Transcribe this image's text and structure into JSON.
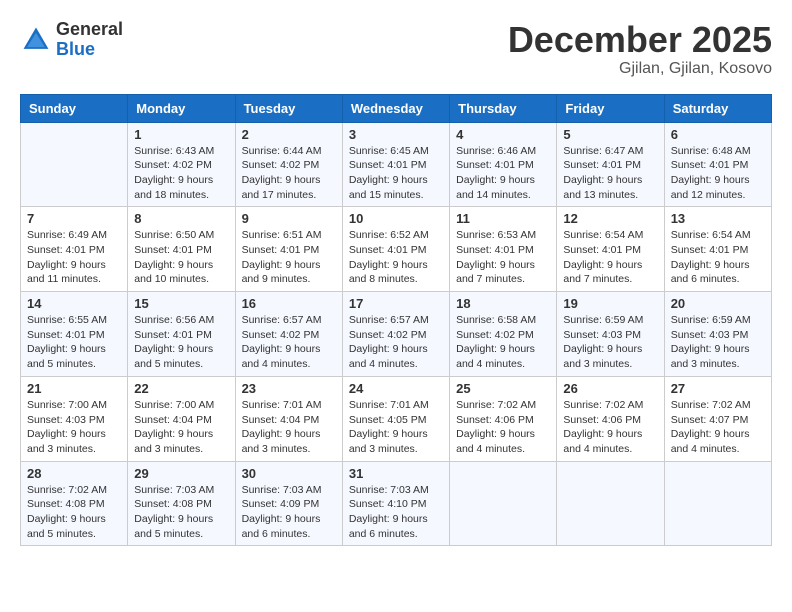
{
  "logo": {
    "general": "General",
    "blue": "Blue"
  },
  "header": {
    "month": "December 2025",
    "location": "Gjilan, Gjilan, Kosovo"
  },
  "days_of_week": [
    "Sunday",
    "Monday",
    "Tuesday",
    "Wednesday",
    "Thursday",
    "Friday",
    "Saturday"
  ],
  "weeks": [
    [
      {
        "day": "",
        "sunrise": "",
        "sunset": "",
        "daylight": ""
      },
      {
        "day": "1",
        "sunrise": "Sunrise: 6:43 AM",
        "sunset": "Sunset: 4:02 PM",
        "daylight": "Daylight: 9 hours and 18 minutes."
      },
      {
        "day": "2",
        "sunrise": "Sunrise: 6:44 AM",
        "sunset": "Sunset: 4:02 PM",
        "daylight": "Daylight: 9 hours and 17 minutes."
      },
      {
        "day": "3",
        "sunrise": "Sunrise: 6:45 AM",
        "sunset": "Sunset: 4:01 PM",
        "daylight": "Daylight: 9 hours and 15 minutes."
      },
      {
        "day": "4",
        "sunrise": "Sunrise: 6:46 AM",
        "sunset": "Sunset: 4:01 PM",
        "daylight": "Daylight: 9 hours and 14 minutes."
      },
      {
        "day": "5",
        "sunrise": "Sunrise: 6:47 AM",
        "sunset": "Sunset: 4:01 PM",
        "daylight": "Daylight: 9 hours and 13 minutes."
      },
      {
        "day": "6",
        "sunrise": "Sunrise: 6:48 AM",
        "sunset": "Sunset: 4:01 PM",
        "daylight": "Daylight: 9 hours and 12 minutes."
      }
    ],
    [
      {
        "day": "7",
        "sunrise": "Sunrise: 6:49 AM",
        "sunset": "Sunset: 4:01 PM",
        "daylight": "Daylight: 9 hours and 11 minutes."
      },
      {
        "day": "8",
        "sunrise": "Sunrise: 6:50 AM",
        "sunset": "Sunset: 4:01 PM",
        "daylight": "Daylight: 9 hours and 10 minutes."
      },
      {
        "day": "9",
        "sunrise": "Sunrise: 6:51 AM",
        "sunset": "Sunset: 4:01 PM",
        "daylight": "Daylight: 9 hours and 9 minutes."
      },
      {
        "day": "10",
        "sunrise": "Sunrise: 6:52 AM",
        "sunset": "Sunset: 4:01 PM",
        "daylight": "Daylight: 9 hours and 8 minutes."
      },
      {
        "day": "11",
        "sunrise": "Sunrise: 6:53 AM",
        "sunset": "Sunset: 4:01 PM",
        "daylight": "Daylight: 9 hours and 7 minutes."
      },
      {
        "day": "12",
        "sunrise": "Sunrise: 6:54 AM",
        "sunset": "Sunset: 4:01 PM",
        "daylight": "Daylight: 9 hours and 7 minutes."
      },
      {
        "day": "13",
        "sunrise": "Sunrise: 6:54 AM",
        "sunset": "Sunset: 4:01 PM",
        "daylight": "Daylight: 9 hours and 6 minutes."
      }
    ],
    [
      {
        "day": "14",
        "sunrise": "Sunrise: 6:55 AM",
        "sunset": "Sunset: 4:01 PM",
        "daylight": "Daylight: 9 hours and 5 minutes."
      },
      {
        "day": "15",
        "sunrise": "Sunrise: 6:56 AM",
        "sunset": "Sunset: 4:01 PM",
        "daylight": "Daylight: 9 hours and 5 minutes."
      },
      {
        "day": "16",
        "sunrise": "Sunrise: 6:57 AM",
        "sunset": "Sunset: 4:02 PM",
        "daylight": "Daylight: 9 hours and 4 minutes."
      },
      {
        "day": "17",
        "sunrise": "Sunrise: 6:57 AM",
        "sunset": "Sunset: 4:02 PM",
        "daylight": "Daylight: 9 hours and 4 minutes."
      },
      {
        "day": "18",
        "sunrise": "Sunrise: 6:58 AM",
        "sunset": "Sunset: 4:02 PM",
        "daylight": "Daylight: 9 hours and 4 minutes."
      },
      {
        "day": "19",
        "sunrise": "Sunrise: 6:59 AM",
        "sunset": "Sunset: 4:03 PM",
        "daylight": "Daylight: 9 hours and 3 minutes."
      },
      {
        "day": "20",
        "sunrise": "Sunrise: 6:59 AM",
        "sunset": "Sunset: 4:03 PM",
        "daylight": "Daylight: 9 hours and 3 minutes."
      }
    ],
    [
      {
        "day": "21",
        "sunrise": "Sunrise: 7:00 AM",
        "sunset": "Sunset: 4:03 PM",
        "daylight": "Daylight: 9 hours and 3 minutes."
      },
      {
        "day": "22",
        "sunrise": "Sunrise: 7:00 AM",
        "sunset": "Sunset: 4:04 PM",
        "daylight": "Daylight: 9 hours and 3 minutes."
      },
      {
        "day": "23",
        "sunrise": "Sunrise: 7:01 AM",
        "sunset": "Sunset: 4:04 PM",
        "daylight": "Daylight: 9 hours and 3 minutes."
      },
      {
        "day": "24",
        "sunrise": "Sunrise: 7:01 AM",
        "sunset": "Sunset: 4:05 PM",
        "daylight": "Daylight: 9 hours and 3 minutes."
      },
      {
        "day": "25",
        "sunrise": "Sunrise: 7:02 AM",
        "sunset": "Sunset: 4:06 PM",
        "daylight": "Daylight: 9 hours and 4 minutes."
      },
      {
        "day": "26",
        "sunrise": "Sunrise: 7:02 AM",
        "sunset": "Sunset: 4:06 PM",
        "daylight": "Daylight: 9 hours and 4 minutes."
      },
      {
        "day": "27",
        "sunrise": "Sunrise: 7:02 AM",
        "sunset": "Sunset: 4:07 PM",
        "daylight": "Daylight: 9 hours and 4 minutes."
      }
    ],
    [
      {
        "day": "28",
        "sunrise": "Sunrise: 7:02 AM",
        "sunset": "Sunset: 4:08 PM",
        "daylight": "Daylight: 9 hours and 5 minutes."
      },
      {
        "day": "29",
        "sunrise": "Sunrise: 7:03 AM",
        "sunset": "Sunset: 4:08 PM",
        "daylight": "Daylight: 9 hours and 5 minutes."
      },
      {
        "day": "30",
        "sunrise": "Sunrise: 7:03 AM",
        "sunset": "Sunset: 4:09 PM",
        "daylight": "Daylight: 9 hours and 6 minutes."
      },
      {
        "day": "31",
        "sunrise": "Sunrise: 7:03 AM",
        "sunset": "Sunset: 4:10 PM",
        "daylight": "Daylight: 9 hours and 6 minutes."
      },
      {
        "day": "",
        "sunrise": "",
        "sunset": "",
        "daylight": ""
      },
      {
        "day": "",
        "sunrise": "",
        "sunset": "",
        "daylight": ""
      },
      {
        "day": "",
        "sunrise": "",
        "sunset": "",
        "daylight": ""
      }
    ]
  ]
}
